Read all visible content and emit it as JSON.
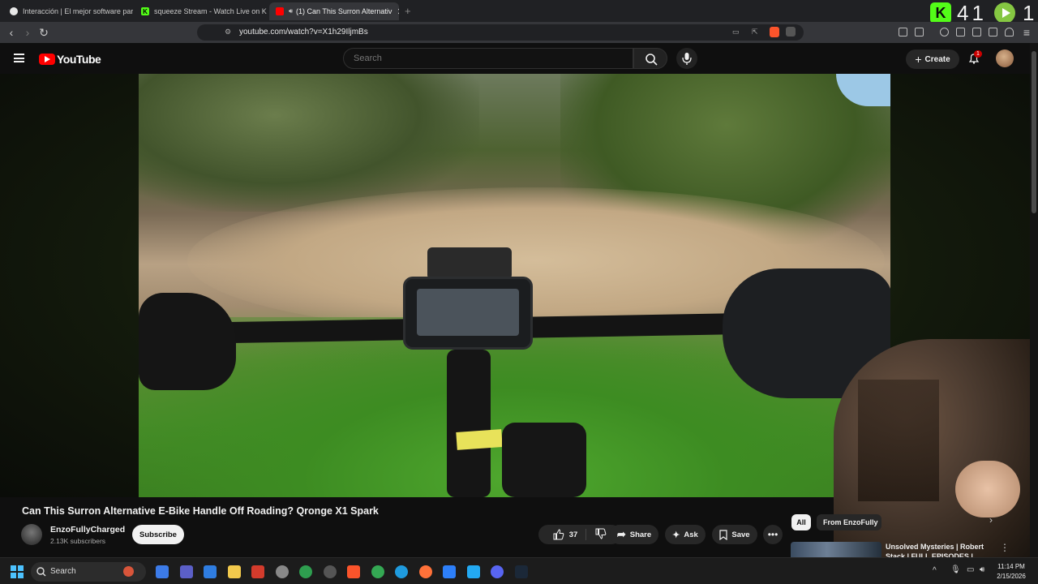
{
  "browser": {
    "tabs": [
      {
        "title": "Interacción | El mejor software para p",
        "favicon": "diamond-icon",
        "color": "#e8e8e8"
      },
      {
        "title": "squeeze Stream - Watch Live on Kick",
        "favicon": "kick-icon",
        "color": "#53fc18"
      },
      {
        "title": "(1) Can This Surron Alternativ",
        "favicon": "youtube-icon",
        "color": "#ff0000",
        "active": true
      }
    ],
    "url": "youtube.com/watch?v=X1h29IljmBs",
    "overlay": {
      "kick_badge": "K",
      "kick_count": "41",
      "rumble_count": "1"
    }
  },
  "youtube": {
    "logo_text": "YouTube",
    "search_placeholder": "Search",
    "create_label": "Create",
    "notification_count": "1"
  },
  "video": {
    "title": "Can This Surron Alternative E-Bike Handle Off Roading? Qronge X1 Spark",
    "channel_name": "EnzoFullyCharged",
    "subscribers": "2.13K subscribers",
    "subscribe_label": "Subscribe",
    "like_count": "37",
    "share_label": "Share",
    "ask_label": "Ask",
    "save_label": "Save"
  },
  "sidebar": {
    "chips": [
      "All",
      "From EnzoFully"
    ],
    "recommendation_title": "Unsolved Mysteries | Robert Stack | FULL EPISODES |"
  },
  "taskbar": {
    "search_label": "Search",
    "time": "11:14 PM",
    "date": "2/15/2026",
    "apps": [
      {
        "name": "app-blue",
        "color": "#3c7be8"
      },
      {
        "name": "app-teams",
        "color": "#5b5fc7"
      },
      {
        "name": "app-r",
        "color": "#2f7de1"
      },
      {
        "name": "file-explorer",
        "color": "#f2c94c"
      },
      {
        "name": "app-red",
        "color": "#d33b2c"
      },
      {
        "name": "app-speed",
        "color": "#888888"
      },
      {
        "name": "app-green",
        "color": "#2e9e4f"
      },
      {
        "name": "app-obs",
        "color": "#555555"
      },
      {
        "name": "brave",
        "color": "#fb542b"
      },
      {
        "name": "chrome",
        "color": "#34a853"
      },
      {
        "name": "edge",
        "color": "#1f9bde"
      },
      {
        "name": "firefox",
        "color": "#ff7139"
      },
      {
        "name": "app-infinity",
        "color": "#2d7ff9"
      },
      {
        "name": "vscode",
        "color": "#23a9f2"
      },
      {
        "name": "discord",
        "color": "#5865f2"
      },
      {
        "name": "steam",
        "color": "#1b2838"
      }
    ]
  }
}
